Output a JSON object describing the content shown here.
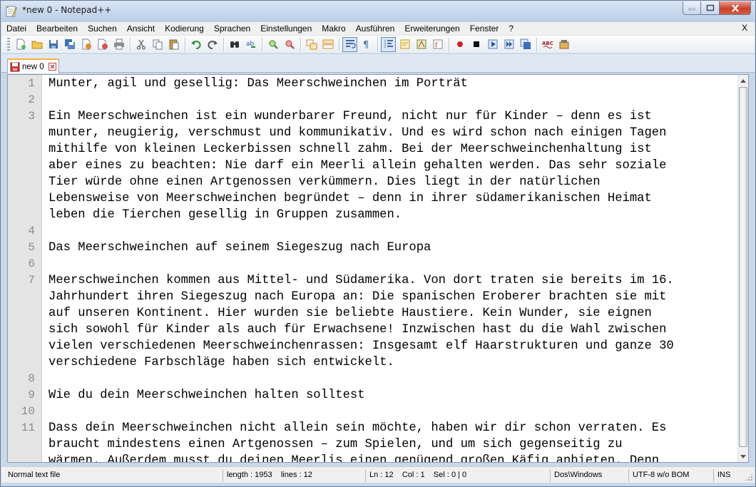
{
  "window": {
    "title": "*new  0 - Notepad++"
  },
  "menu": {
    "items": [
      "Datei",
      "Bearbeiten",
      "Suchen",
      "Ansicht",
      "Kodierung",
      "Sprachen",
      "Einstellungen",
      "Makro",
      "Ausführen",
      "Erweiterungen",
      "Fenster",
      "?"
    ],
    "close_label": "X"
  },
  "toolbar": {
    "icons": [
      "new-file-icon",
      "open-file-icon",
      "save-icon",
      "save-all-icon",
      "close-file-icon",
      "close-all-icon",
      "print-icon",
      "cut-icon",
      "copy-icon",
      "paste-icon",
      "undo-icon",
      "redo-icon",
      "find-icon",
      "replace-icon",
      "zoom-in-icon",
      "zoom-out-icon",
      "sync-vertical-icon",
      "sync-horizontal-icon",
      "word-wrap-icon",
      "show-all-chars-icon",
      "indent-guide-icon",
      "user-defined-language-icon",
      "doc-map-icon",
      "function-list-icon",
      "folder-as-workspace-icon",
      "record-macro-icon",
      "stop-macro-icon",
      "play-macro-icon",
      "run-macro-multiple-icon",
      "save-macro-icon",
      "spell-check-icon",
      "plugin-icon"
    ]
  },
  "tab": {
    "label": "new  0"
  },
  "editor": {
    "lines": [
      {
        "num": "1",
        "text": "Munter, agil und gesellig: Das Meerschweinchen im Porträt"
      },
      {
        "num": "2",
        "text": ""
      },
      {
        "num": "3",
        "text": "Ein Meerschweinchen ist ein wunderbarer Freund, nicht nur für Kinder – denn es ist"
      },
      {
        "num": "",
        "text": "munter, neugierig, verschmust und kommunikativ. Und es wird schon nach einigen Tagen"
      },
      {
        "num": "",
        "text": "mithilfe von kleinen Leckerbissen schnell zahm. Bei der Meerschweinchenhaltung ist"
      },
      {
        "num": "",
        "text": "aber eines zu beachten: Nie darf ein Meerli allein gehalten werden. Das sehr soziale"
      },
      {
        "num": "",
        "text": "Tier würde ohne einen Artgenossen verkümmern. Dies liegt in der natürlichen"
      },
      {
        "num": "",
        "text": "Lebensweise von Meerschweinchen begründet – denn in ihrer südamerikanischen Heimat"
      },
      {
        "num": "",
        "text": "leben die Tierchen gesellig in Gruppen zusammen."
      },
      {
        "num": "4",
        "text": ""
      },
      {
        "num": "5",
        "text": "Das Meerschweinchen auf seinem Siegeszug nach Europa"
      },
      {
        "num": "6",
        "text": ""
      },
      {
        "num": "7",
        "text": "Meerschweinchen kommen aus Mittel- und Südamerika. Von dort traten sie bereits im 16."
      },
      {
        "num": "",
        "text": "Jahrhundert ihren Siegeszug nach Europa an: Die spanischen Eroberer brachten sie mit"
      },
      {
        "num": "",
        "text": "auf unseren Kontinent. Hier wurden sie beliebte Haustiere. Kein Wunder, sie eignen"
      },
      {
        "num": "",
        "text": "sich sowohl für Kinder als auch für Erwachsene! Inzwischen hast du die Wahl zwischen"
      },
      {
        "num": "",
        "text": "vielen verschiedenen Meerschweinchenrassen: Insgesamt elf Haarstrukturen und ganze 30"
      },
      {
        "num": "",
        "text": "verschiedene Farbschläge haben sich entwickelt."
      },
      {
        "num": "8",
        "text": ""
      },
      {
        "num": "9",
        "text": "Wie du dein Meerschweinchen halten solltest"
      },
      {
        "num": "10",
        "text": ""
      },
      {
        "num": "11",
        "text": "Dass dein Meerschweinchen nicht allein sein möchte, haben wir dir schon verraten. Es"
      },
      {
        "num": "",
        "text": "braucht mindestens einen Artgenossen – zum Spielen, und um sich gegenseitig zu"
      },
      {
        "num": "",
        "text": "wärmen. Außerdem musst du deinen Meerlis einen genügend großen Käfig anbieten. Denn"
      }
    ]
  },
  "status": {
    "file_type": "Normal text file",
    "length": "length : 1953    lines : 12",
    "position": "Ln : 12    Col : 1    Sel : 0 | 0",
    "eol": "Dos\\Windows",
    "encoding": "UTF-8 w/o BOM",
    "mode": "INS"
  }
}
